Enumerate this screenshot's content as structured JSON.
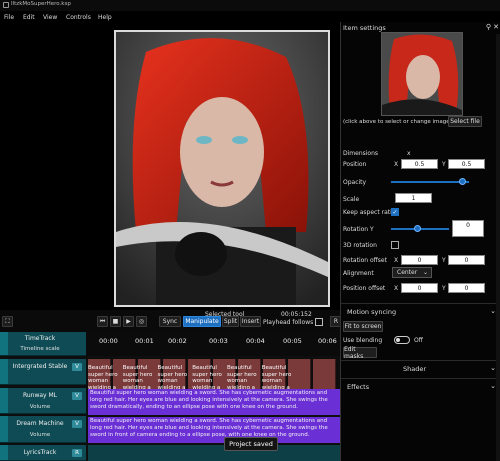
{
  "window": {
    "title": "IltzkMoSuperHero.ksp"
  },
  "menu": [
    "File",
    "Edit",
    "View",
    "Controls",
    "Help"
  ],
  "transport": {
    "selected_tool_label": "Selected tool",
    "time": "00:05:152",
    "sync_label": "Sync",
    "tools": [
      "Manipulate",
      "Split",
      "Insert"
    ],
    "active_tool": "Manipulate",
    "playhead_follows": "Playhead follows",
    "r_label": "R"
  },
  "timeline": {
    "ruler": [
      "00:00",
      "00:01",
      "00:02",
      "00:03",
      "00:04",
      "00:05",
      "00:06"
    ],
    "tracks": [
      {
        "name": "TimeTrack",
        "sub": "Timeline scale"
      },
      {
        "name": "Intergrated Stable",
        "btn": "V"
      },
      {
        "name": "Runway ML",
        "sub": "Volume",
        "btn": "V"
      },
      {
        "name": "Dream Machine",
        "sub": "Volume",
        "btn": "V"
      },
      {
        "name": "LyricsTrack",
        "btn": "R"
      }
    ],
    "clip_caption": "Beautiful super hero woman wielding a",
    "lyrics_a": "Beautiful super hero woman wielding a sword. She has cybernetic augmentations and long red hair. Her eyes are blue and looking intensively at the camera. She swings the sword dramatically, ending to an ellipse pose with one knee on the ground.",
    "lyrics_b": "Beautiful super hero woman wielding a sword. She has cybernetic augmentations and long red hair. Her eyes are blue and looking intensively at the camera. She swings the sword in front of camera ending to a ellipse pose, with one knee on the ground.",
    "toast": "Project saved"
  },
  "panel": {
    "title": "Item settings",
    "change_image_hint": "(click above to select or change image)",
    "select_file": "Select file",
    "dimensions_label": "Dimensions",
    "dimensions_x": "x",
    "position_label": "Position",
    "position": {
      "x_label": "X",
      "x": "0.5",
      "y_label": "Y",
      "y": "0.5"
    },
    "opacity_label": "Opacity",
    "opacity_value": 0.92,
    "scale_label": "Scale",
    "scale_value": "1",
    "keep_aspect_label": "Keep aspect ratio",
    "rotation_y_label": "Rotation Y",
    "rotation_y_value": "0",
    "rotation_y_level": 0.45,
    "rotation_3d_label": "3D rotation",
    "rotation_offset_label": "Rotation offset",
    "rotation_offset": {
      "x_label": "X",
      "x": "0",
      "y_label": "Y",
      "y": "0"
    },
    "alignment_label": "Alignment",
    "alignment_value": "Center",
    "position_offset_label": "Position offset",
    "position_offset": {
      "x_label": "X",
      "x": "0",
      "y_label": "Y",
      "y": "0"
    },
    "motion_syncing": "Motion syncing",
    "fit_to_screen": "Fit to screen",
    "use_blending": "Use blending",
    "blending_state": "Off",
    "edit_masks": "Edit masks",
    "shader": "Shader",
    "effects": "Effects"
  },
  "colors": {
    "accent": "#1d6fbf",
    "track_header": "#0e4b54",
    "lyrics_lane": "#6b2fd6",
    "timeline_teal": "#0c3f46"
  }
}
